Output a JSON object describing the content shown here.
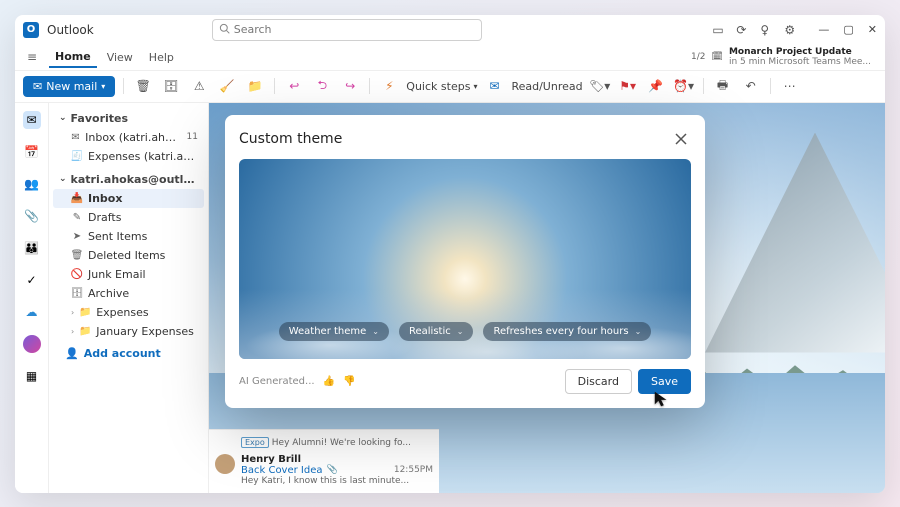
{
  "app": {
    "name": "Outlook"
  },
  "search": {
    "placeholder": "Search"
  },
  "titleButtons": {
    "minimize": "—",
    "restore": "▢",
    "close": "✕"
  },
  "reminder": {
    "count": "1/2",
    "title": "Monarch Project Update",
    "sub": "in 5 min Microsoft Teams Mee..."
  },
  "tabs": {
    "home": "Home",
    "view": "View",
    "help": "Help"
  },
  "toolbar": {
    "newmail": "New mail",
    "quicksteps": "Quick steps",
    "readunread": "Read/Unread"
  },
  "sidebar": {
    "favorites": "Favorites",
    "items": [
      {
        "icon": "inbox",
        "label": "Inbox (katri.ahokas@...",
        "badge": "11"
      },
      {
        "icon": "receipt",
        "label": "Expenses (katri.ahoka...",
        "badge": ""
      }
    ],
    "account": "katri.ahokas@outlook....",
    "folders": [
      {
        "icon": "inbox",
        "label": "Inbox",
        "active": true
      },
      {
        "icon": "draft",
        "label": "Drafts"
      },
      {
        "icon": "sent",
        "label": "Sent Items"
      },
      {
        "icon": "trash",
        "label": "Deleted Items"
      },
      {
        "icon": "junk",
        "label": "Junk Email"
      },
      {
        "icon": "archive",
        "label": "Archive"
      },
      {
        "icon": "folder",
        "label": "Expenses",
        "expandable": true
      },
      {
        "icon": "folder",
        "label": "January Expenses",
        "expandable": true
      }
    ],
    "add": "Add account"
  },
  "messages": [
    {
      "tag": "Expo",
      "preview": "Hey Alumni! We're looking fo..."
    },
    {
      "name": "Henry Brill",
      "subject": "Back Cover Idea",
      "time": "12:55PM",
      "preview": "Hey Katri, I know this is last minute...",
      "attach": true
    }
  ],
  "dialog": {
    "title": "Custom theme",
    "pill1": "Weather theme",
    "pill2": "Realistic",
    "pill3": "Refreshes every four hours",
    "aigen": "AI Generated...",
    "discard": "Discard",
    "save": "Save"
  }
}
